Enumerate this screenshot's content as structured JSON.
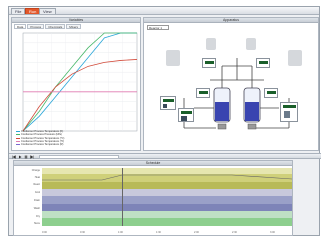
{
  "window": {
    "tabs": [
      {
        "label": "File",
        "active": false
      },
      {
        "label": "Run",
        "active": true
      },
      {
        "label": "View",
        "active": false
      }
    ]
  },
  "left_panel": {
    "title": "Variables",
    "subtabs": [
      "Data",
      "Process",
      "Chemicals",
      "Mixers"
    ],
    "legend": [
      {
        "label": "Condenser Process Temperature (K)",
        "color": "#2aa6d8"
      },
      {
        "label": "Condenser Process Pressure (kPa)",
        "color": "#48b86a"
      },
      {
        "label": "Condenser Process Temperature (°C)",
        "color": "#d24a3a"
      },
      {
        "label": "Condenser Process Temperature (°F)",
        "color": "#e07bb0"
      },
      {
        "label": "Condenser Process Temperature (R)",
        "color": "#7a6ad0"
      }
    ]
  },
  "right_panel": {
    "title": "Apparatus",
    "selector": "Reactor 1"
  },
  "timeline": {
    "title": "Schedule",
    "lanes": [
      "Charge",
      "Heat",
      "React",
      "Cool",
      "Drain",
      "Wash",
      "Dry",
      "Store"
    ],
    "axis": [
      "0:00",
      "0:30",
      "1:00",
      "1:30",
      "2:00",
      "2:30",
      "3:00"
    ]
  },
  "chart_data": {
    "type": "line",
    "title": "",
    "xlabel": "",
    "ylabel": "",
    "series": [
      {
        "name": "Condenser Process Temperature (K)",
        "values": [
          0,
          15,
          35,
          55,
          75,
          95,
          100,
          100
        ]
      },
      {
        "name": "Condenser Process Pressure (kPa)",
        "values": [
          0,
          20,
          45,
          65,
          85,
          100,
          100,
          100
        ]
      },
      {
        "name": "Condenser Process Temperature (°C)",
        "values": [
          0,
          25,
          45,
          58,
          66,
          70,
          72,
          73
        ]
      },
      {
        "name": "Condenser Process Temperature (°F)",
        "values": [
          40,
          40,
          40,
          40,
          40,
          40,
          40,
          40
        ]
      }
    ],
    "x": [
      0,
      1,
      2,
      3,
      4,
      5,
      6,
      7
    ],
    "ylim": [
      0,
      100
    ],
    "grid": true
  }
}
